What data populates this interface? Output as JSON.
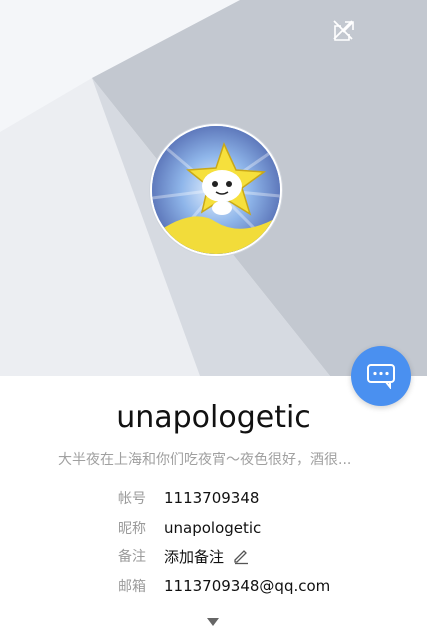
{
  "profile": {
    "name": "unapologetic",
    "signature": "大半夜在上海和你们吃夜宵～夜色很好，酒很..."
  },
  "info": {
    "account": {
      "label": "帐号",
      "value": "1113709348"
    },
    "nickname": {
      "label": "昵称",
      "value": "unapologetic"
    },
    "remark": {
      "label": "备注",
      "value": "添加备注"
    },
    "email": {
      "label": "邮箱",
      "value": "1113709348@qq.com"
    }
  },
  "icons": {
    "share": "share-icon",
    "close": "close-icon",
    "chat": "chat-bubble-icon",
    "edit": "pencil-icon",
    "expand": "chevron-down-icon"
  },
  "colors": {
    "accent": "#4a90f0",
    "banner_light": "#eceef2",
    "banner_dark": "#c3c8d0"
  }
}
